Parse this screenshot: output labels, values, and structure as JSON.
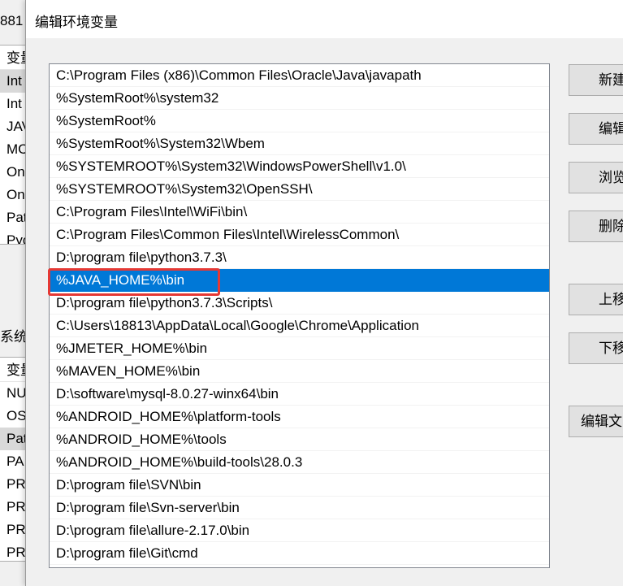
{
  "background": {
    "title_fragment": "881",
    "section_label_fragment": "系统变",
    "user_vars": {
      "header": "变量",
      "rows": [
        "Int",
        "Int",
        "JAV",
        "MC",
        "On",
        "On",
        "Pat",
        "Pyc"
      ]
    },
    "system_vars": {
      "header": "变量",
      "rows": [
        "NU",
        "OS",
        "Pat",
        "PA",
        "PR",
        "PR",
        "PR",
        "PR"
      ]
    }
  },
  "dialog": {
    "title": "编辑环境变量",
    "entries": [
      "C:\\Program Files (x86)\\Common Files\\Oracle\\Java\\javapath",
      "%SystemRoot%\\system32",
      "%SystemRoot%",
      "%SystemRoot%\\System32\\Wbem",
      "%SYSTEMROOT%\\System32\\WindowsPowerShell\\v1.0\\",
      "%SYSTEMROOT%\\System32\\OpenSSH\\",
      "C:\\Program Files\\Intel\\WiFi\\bin\\",
      "C:\\Program Files\\Common Files\\Intel\\WirelessCommon\\",
      "D:\\program file\\python3.7.3\\",
      "%JAVA_HOME%\\bin",
      "D:\\program file\\python3.7.3\\Scripts\\",
      "C:\\Users\\18813\\AppData\\Local\\Google\\Chrome\\Application",
      "%JMETER_HOME%\\bin",
      "%MAVEN_HOME%\\bin",
      "D:\\software\\mysql-8.0.27-winx64\\bin",
      "%ANDROID_HOME%\\platform-tools",
      "%ANDROID_HOME%\\tools",
      "%ANDROID_HOME%\\build-tools\\28.0.3",
      "D:\\program file\\SVN\\bin",
      "D:\\program file\\Svn-server\\bin",
      "D:\\program file\\allure-2.17.0\\bin",
      "D:\\program file\\Git\\cmd"
    ],
    "selected_index": 9,
    "buttons": {
      "new": "新建",
      "edit": "编辑",
      "browse": "浏览",
      "delete": "删除",
      "move_up": "上移",
      "move_down": "下移",
      "edit_text": "编辑文"
    }
  },
  "colors": {
    "selection": "#0078d7",
    "highlight_box": "#e53935"
  }
}
